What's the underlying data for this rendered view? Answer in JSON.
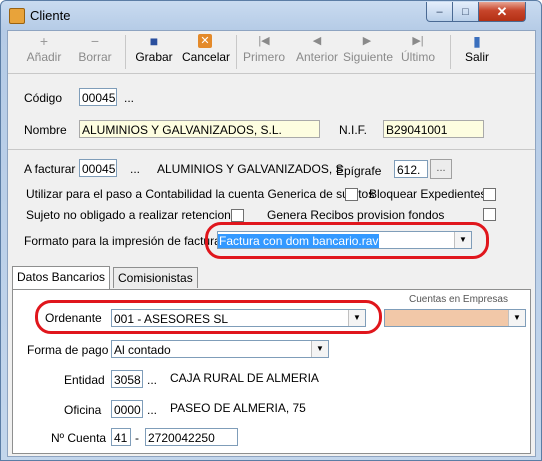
{
  "window": {
    "title": "Cliente",
    "minimize": "–",
    "maximize": "□",
    "close": "✕"
  },
  "toolbar": {
    "buttons": [
      {
        "label": "Añadir",
        "icon": "+",
        "enabled": false
      },
      {
        "label": "Borrar",
        "icon": "−",
        "enabled": false
      },
      {
        "label": "Grabar",
        "icon": "■",
        "enabled": true
      },
      {
        "label": "Cancelar",
        "icon": "✕",
        "enabled": true
      },
      {
        "label": "Primero",
        "icon": "|◀",
        "enabled": false
      },
      {
        "label": "Anterior",
        "icon": "◀",
        "enabled": false
      },
      {
        "label": "Siguiente",
        "icon": "▶",
        "enabled": false
      },
      {
        "label": "Último",
        "icon": "▶|",
        "enabled": false
      },
      {
        "label": "Salir",
        "icon": "▮",
        "enabled": true
      }
    ]
  },
  "form": {
    "codigo": {
      "label": "Código",
      "value": "00045",
      "ellipsis": "..."
    },
    "nombre": {
      "label": "Nombre",
      "value": "ALUMINIOS Y GALVANIZADOS, S.L."
    },
    "nif": {
      "label": "N.I.F.",
      "value": "B29041001"
    },
    "a_facturar": {
      "label": "A facturar",
      "value": "00045",
      "ellipsis": "...",
      "name": "ALUMINIOS Y GALVANIZADOS, S"
    },
    "epigrafe": {
      "label": "Epígrafe",
      "value": "612.",
      "button": "..."
    },
    "cuenta_generica": {
      "label": "Utilizar para el paso a Contabilidad la cuenta Generica de sujetos",
      "checked": false
    },
    "bloquear": {
      "label": "Bloquear Expedientes",
      "checked": false
    },
    "retenciones": {
      "label": "Sujeto no obligado a realizar retenciones",
      "checked": false
    },
    "recibos": {
      "label": "Genera Recibos provision fondos",
      "checked": false
    },
    "formato": {
      "label": "Formato para la impresión de factura",
      "value": "Factura con dom bancario.rav"
    }
  },
  "tabs": [
    {
      "label": "Datos Bancarios",
      "active": true
    },
    {
      "label": "Comisionistas",
      "active": false
    }
  ],
  "banking": {
    "ordenante": {
      "label": "Ordenante",
      "value": "001 - ASESORES SL"
    },
    "cuentas_empresas": {
      "label": "Cuentas en Empresas",
      "value": ""
    },
    "forma_pago": {
      "label": "Forma de pago",
      "value": "Al contado"
    },
    "entidad": {
      "label": "Entidad",
      "value": "3058",
      "ellipsis": "...",
      "name": "CAJA RURAL DE ALMERIA"
    },
    "oficina": {
      "label": "Oficina",
      "value": "0000",
      "ellipsis": "...",
      "name": "PASEO DE ALMERIA, 75"
    },
    "cuenta": {
      "label": "Nº Cuenta",
      "prefix": "41",
      "dash": "-",
      "value": "2720042250"
    }
  },
  "colors": {
    "highlight": "#e0161c",
    "selection": "#3399ff"
  }
}
